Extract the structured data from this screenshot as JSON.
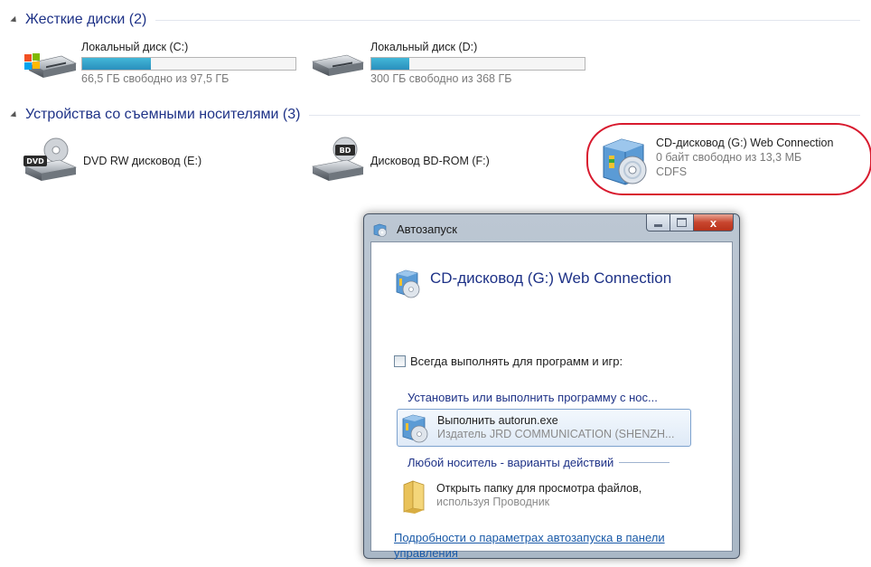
{
  "groups": {
    "hard": {
      "title": "Жесткие диски (2)"
    },
    "removable": {
      "title": "Устройства со съемными носителями (3)"
    }
  },
  "drives": {
    "c": {
      "name": "Локальный диск (C:)",
      "free": "66,5 ГБ свободно из 97,5 ГБ",
      "used_fraction": 0.32
    },
    "d": {
      "name": "Локальный диск (D:)",
      "free": "300 ГБ свободно из 368 ГБ",
      "used_fraction": 0.18
    },
    "e": {
      "name": "DVD RW дисковод (E:)",
      "badge": "DVD"
    },
    "f": {
      "name": "Дисковод BD-ROM (F:)",
      "badge": "BD"
    },
    "g": {
      "name": "CD-дисковод (G:) Web Connection",
      "free": "0 байт свободно из 13,3 МБ",
      "fs": "CDFS"
    }
  },
  "autoplay": {
    "title": "Автозапуск",
    "close_glyph": "x",
    "device": "CD-дисковод (G:) Web Connection",
    "always_label": "Всегда выполнять для программ и игр:",
    "section_install": "Установить или выполнить программу с нос...",
    "run_main": "Выполнить autorun.exe",
    "run_sub": "Издатель JRD COMMUNICATION (SHENZH...",
    "section_general": "Любой носитель - варианты действий",
    "open_main": "Открыть папку для просмотра файлов,",
    "open_sub": "используя Проводник",
    "settings_link": "Подробности о параметрах автозапуска в панели управления"
  },
  "colors": {
    "accent": "#1e3287",
    "bar_fill": "#2a8fbd",
    "highlight": "#d81a2e",
    "link": "#1a5aa8"
  }
}
